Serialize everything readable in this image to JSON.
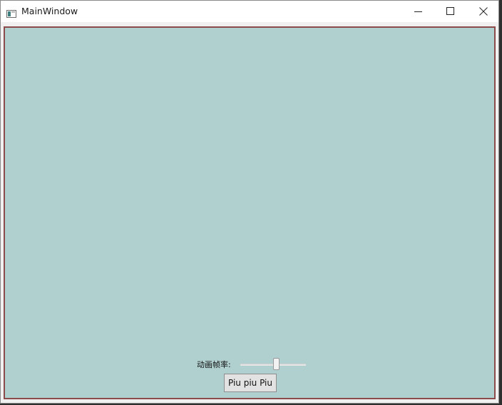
{
  "window": {
    "title": "MainWindow",
    "icon": "app-window-icon",
    "controls": {
      "minimize_icon": "minimize-icon",
      "maximize_icon": "maximize-icon",
      "close_icon": "close-icon"
    }
  },
  "content": {
    "background_color": "#b0d0d0",
    "border_color": "#8b4b4b",
    "fps_label": "动画帧率:",
    "fps_slider_value": 0.55,
    "button_label": "Piu piu Piu"
  }
}
